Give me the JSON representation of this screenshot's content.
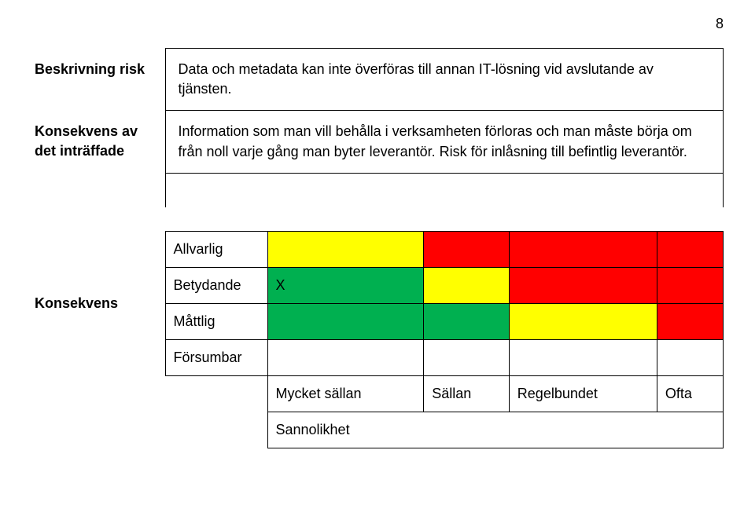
{
  "pageNumber": "8",
  "info": {
    "row1": {
      "label": "Beskrivning risk",
      "text": "Data och metadata kan inte överföras till annan IT-lösning vid avslutande av tjänsten."
    },
    "row2": {
      "label": "Konsekvens av det inträffade",
      "text": "Information som man vill behålla i verksamheten förloras och man måste börja om från noll varje gång man byter leverantör. Risk för inlåsning till befintlig leverantör."
    }
  },
  "matrix": {
    "leftHeader": "Konsekvens",
    "rows": [
      {
        "label": "Allvarlig",
        "cells": [
          "",
          "",
          "",
          ""
        ],
        "colors": [
          "yellow",
          "red",
          "red",
          "red"
        ]
      },
      {
        "label": "Betydande",
        "cells": [
          "X",
          "",
          "",
          ""
        ],
        "colors": [
          "green",
          "yellow",
          "red",
          "red"
        ]
      },
      {
        "label": "Måttlig",
        "cells": [
          "",
          "",
          "",
          ""
        ],
        "colors": [
          "green",
          "green",
          "yellow",
          "red"
        ]
      },
      {
        "label": "Försumbar",
        "cells": [
          "",
          "",
          "",
          ""
        ],
        "colors": [
          "",
          "",
          "",
          ""
        ]
      }
    ],
    "colHeaders": [
      "Mycket sällan",
      "Sällan",
      "Regelbundet",
      "Ofta"
    ],
    "bottomLabel": "Sannolikhet"
  }
}
